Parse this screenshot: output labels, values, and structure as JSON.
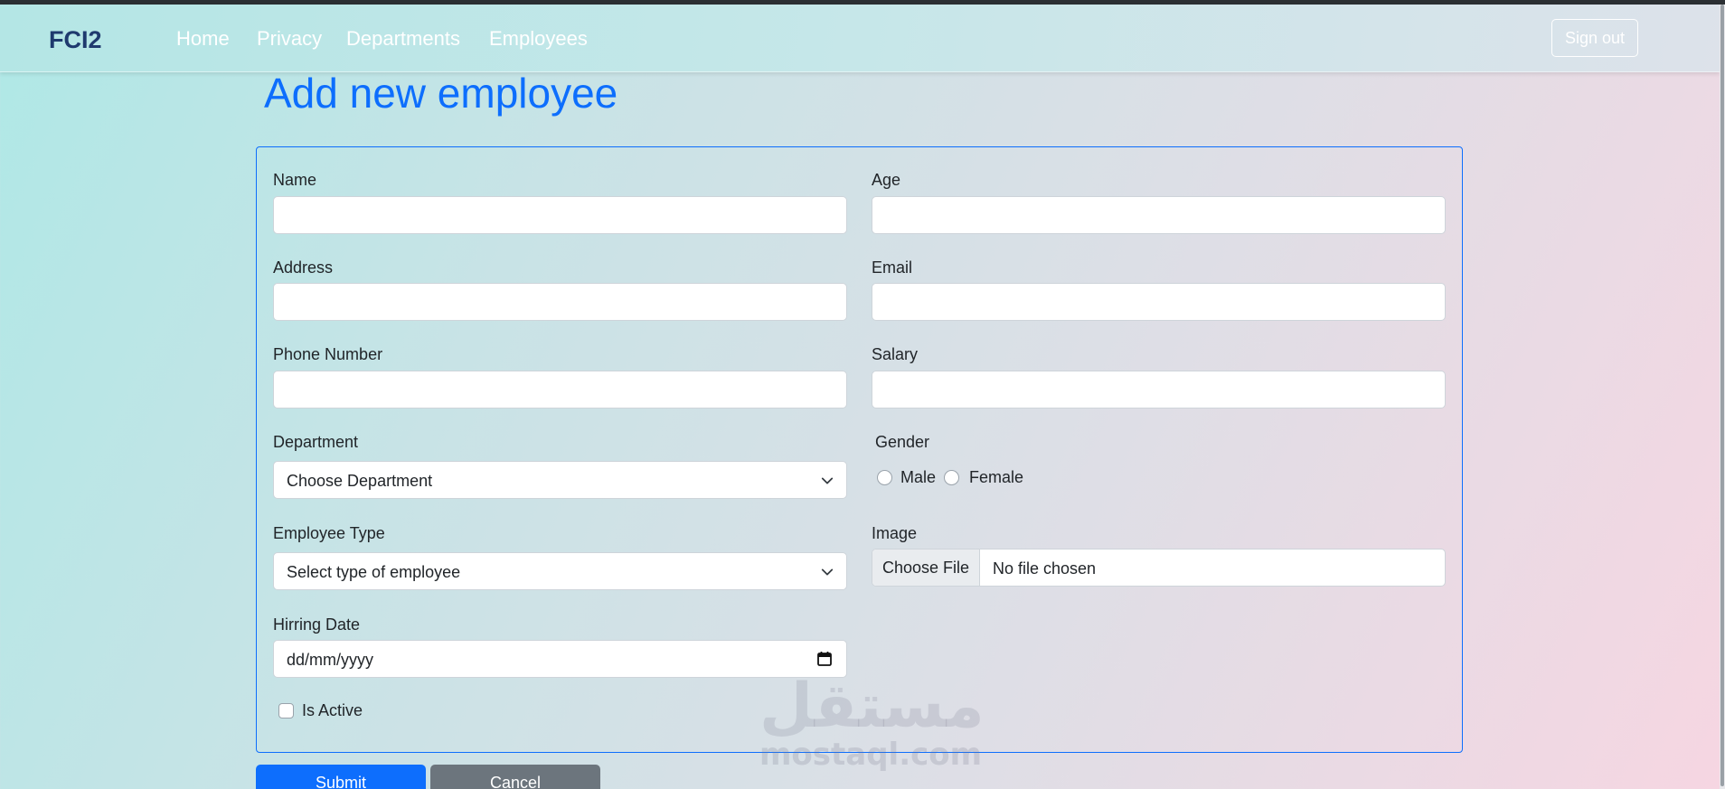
{
  "navbar": {
    "brand": "FCI2",
    "links": [
      "Home",
      "Privacy",
      "Departments",
      "Employees"
    ],
    "signout_label": "Sign out"
  },
  "page": {
    "title": "Add new employee"
  },
  "form": {
    "name_label": "Name",
    "age_label": "Age",
    "address_label": "Address",
    "email_label": "Email",
    "phone_label": "Phone Number",
    "salary_label": "Salary",
    "department_label": "Department",
    "department_value": "Choose Department",
    "gender_label": "Gender",
    "gender_options": [
      "Male",
      "Female"
    ],
    "employee_type_label": "Employee Type",
    "employee_type_value": "Select type of employee",
    "image_label": "Image",
    "file_button_label": "Choose File",
    "file_status": "No file chosen",
    "hiring_date_label": "Hirring Date",
    "hiring_date_value": "dd/mm/yyyy",
    "is_active_label": "Is Active",
    "submit_label": "Submit",
    "cancel_label": "Cancel"
  },
  "watermark": {
    "arabic": "مستقل",
    "latin": "mostaql.com"
  },
  "colors": {
    "accent": "#0d6efd",
    "brand": "#1f3a6e",
    "cancel": "#6c757d"
  },
  "icons": [
    "chevron-down-icon",
    "calendar-icon"
  ]
}
